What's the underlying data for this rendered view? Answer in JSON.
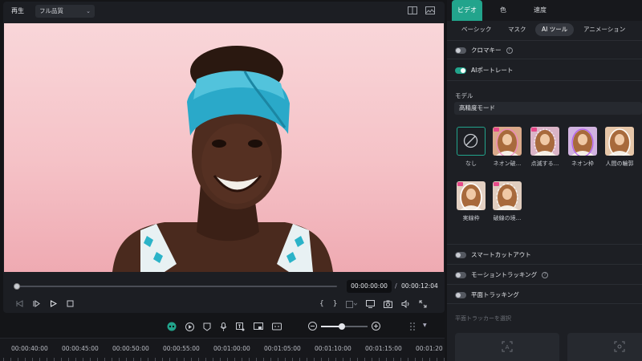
{
  "player": {
    "label": "再生",
    "quality": "フル品質",
    "current_time": "00:00:00:00",
    "separator": "/",
    "total_time": "00:00:12:04",
    "progress": 0.0
  },
  "toolbar": {
    "zoom_level": 0.45
  },
  "timeline": {
    "ticks": [
      "00:00:40:00",
      "00:00:45:00",
      "00:00:50:00",
      "00:00:55:00",
      "00:01:00:00",
      "00:01:05:00",
      "00:01:10:00",
      "00:01:15:00",
      "00:01:20"
    ]
  },
  "panel": {
    "tabs": [
      {
        "label": "ビデオ",
        "active": true
      },
      {
        "label": "色",
        "active": false
      },
      {
        "label": "速度",
        "active": false
      }
    ],
    "subtabs": [
      {
        "label": "ベーシック",
        "active": false
      },
      {
        "label": "マスク",
        "active": false
      },
      {
        "label": "AI ツール",
        "active": true
      },
      {
        "label": "アニメーション",
        "active": false
      }
    ],
    "chroma_key": {
      "label": "クロマキー",
      "on": false
    },
    "ai_portrait": {
      "label": "AIポートレート",
      "on": true
    },
    "model_label": "モデル",
    "model_value": "高精度モード",
    "effects": [
      {
        "label": "なし",
        "selected": true
      },
      {
        "label": "ネオン破..."
      },
      {
        "label": "点滅する..."
      },
      {
        "label": "ネオン枠"
      },
      {
        "label": "人間の輪郭"
      },
      {
        "label": "実線枠"
      },
      {
        "label": "破線の境..."
      }
    ],
    "smart_cutout": {
      "label": "スマートカットアウト",
      "on": false
    },
    "motion_tracking": {
      "label": "モーショントラッキング",
      "on": false
    },
    "planar_tracking": {
      "label": "平面トラッキング",
      "on": false
    },
    "tracker_select": "平面トラッカーを選択"
  },
  "colors": {
    "accent": "#22a48c",
    "panel_bg": "#1d1f24",
    "video_bg": "#f5c2c7"
  }
}
